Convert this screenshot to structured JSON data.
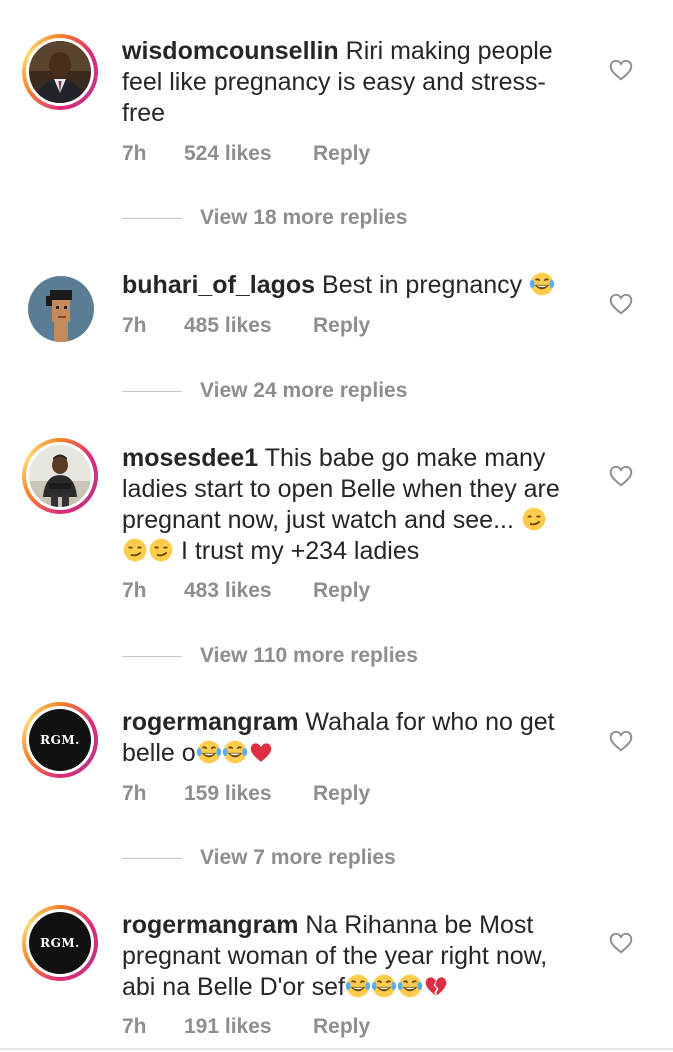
{
  "comments": [
    {
      "username": "wisdomcounsellin",
      "text": " Riri making people feel like pregnancy is easy and stress-free",
      "time": "7h",
      "likes": "524 likes",
      "reply": "Reply",
      "view_replies": "View 18 more replies"
    },
    {
      "username": "buhari_of_lagos",
      "text": " Best in pregnancy ",
      "emojis": [
        "laughing-tears-emoji"
      ],
      "time": "7h",
      "likes": "485 likes",
      "reply": "Reply",
      "view_replies": "View 24 more replies"
    },
    {
      "username": "mosesdee1",
      "text": " This babe go make many ladies start to open Belle when they are pregnant now, just watch and see... ",
      "text_after": " I trust my +234 ladies",
      "emojis": [
        "smirk-emoji",
        "smirk-emoji",
        "smirk-emoji"
      ],
      "time": "7h",
      "likes": "483 likes",
      "reply": "Reply",
      "view_replies": "View 110 more replies"
    },
    {
      "username": "rogermangram",
      "text": " Wahala for who no get belle o",
      "avatar_text": "RGM.",
      "emojis": [
        "laughing-tears-emoji",
        "laughing-tears-emoji",
        "red-heart-emoji"
      ],
      "time": "7h",
      "likes": "159 likes",
      "reply": "Reply",
      "view_replies": "View 7 more replies"
    },
    {
      "username": "rogermangram",
      "text": " Na Rihanna be Most pregnant woman of the year right now, abi na Belle D'or sef",
      "avatar_text": "RGM.",
      "emojis": [
        "laughing-tears-emoji",
        "laughing-tears-emoji",
        "laughing-tears-emoji",
        "broken-heart-emoji"
      ],
      "time": "7h",
      "likes": "191 likes",
      "reply": "Reply"
    }
  ],
  "icons": {
    "like": "heart-outline-icon"
  },
  "colors": {
    "meta": "#8e8e8e",
    "text": "#262626",
    "ring_start": "#f58529",
    "ring_end": "#dd2a7b"
  }
}
